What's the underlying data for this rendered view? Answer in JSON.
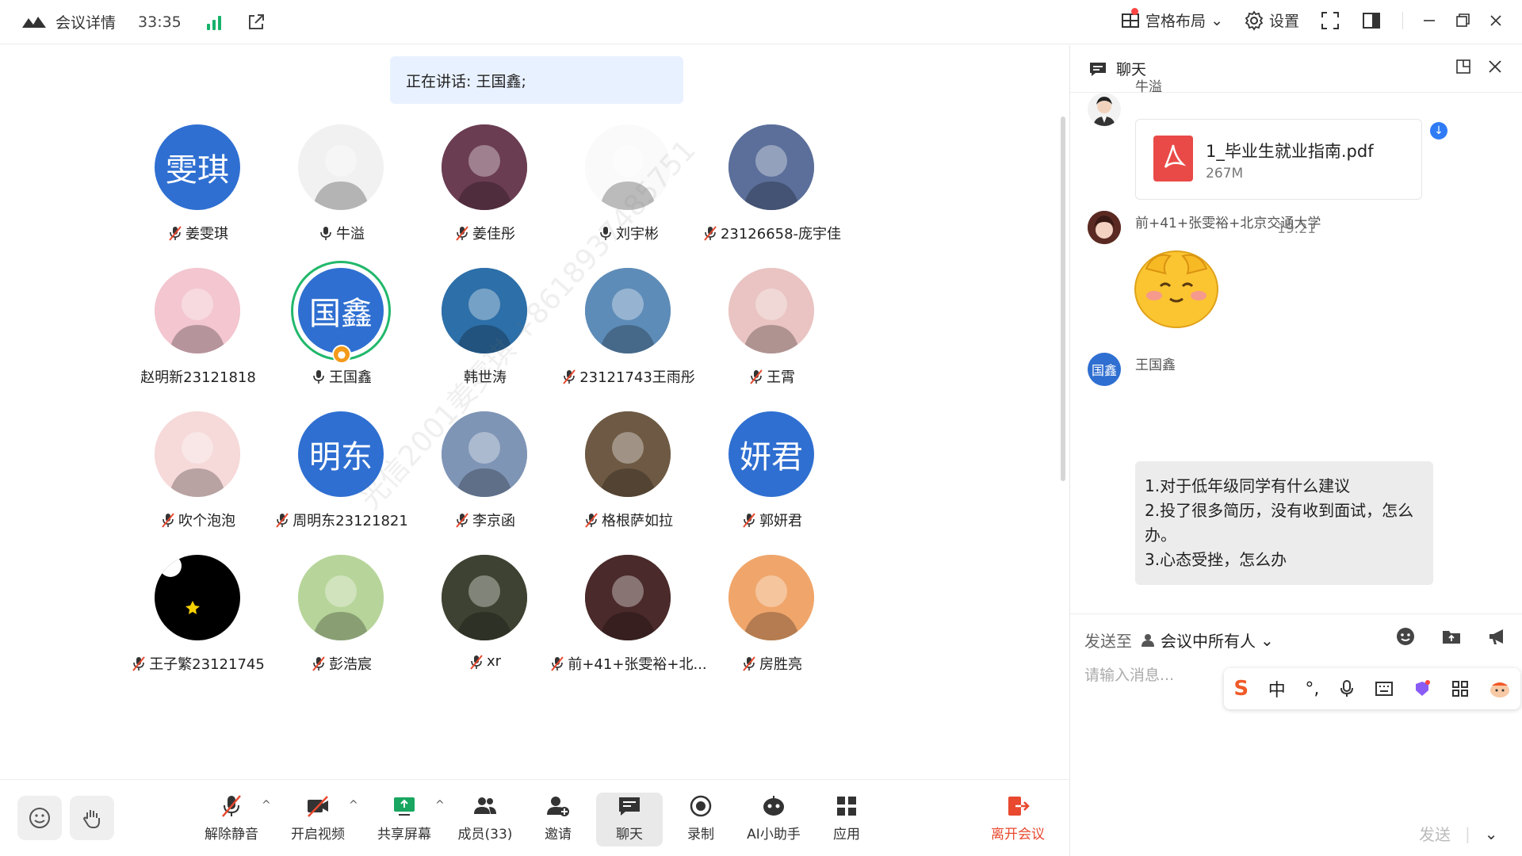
{
  "topbar": {
    "meeting_details": "会议详情",
    "timer": "33:35",
    "layout_label": "宫格布局",
    "settings_label": "设置"
  },
  "stage": {
    "speaking_prefix": "正在讲话: 王国鑫;",
    "watermark": "光信2001姜雯琪 +8618937485751"
  },
  "participants": [
    {
      "name": "姜雯琪",
      "avatar_text": "雯琪",
      "mic": "muted"
    },
    {
      "name": "牛溢",
      "avatar_text": "",
      "mic": "on"
    },
    {
      "name": "姜佳彤",
      "avatar_text": "",
      "mic": "muted"
    },
    {
      "name": "刘宇彬",
      "avatar_text": "",
      "mic": "on"
    },
    {
      "name": "23126658-庞宇佳",
      "avatar_text": "",
      "mic": "muted"
    },
    {
      "name": "赵明新23121818",
      "avatar_text": "",
      "mic": "none"
    },
    {
      "name": "王国鑫",
      "avatar_text": "国鑫",
      "mic": "on"
    },
    {
      "name": "韩世涛",
      "avatar_text": "",
      "mic": "none"
    },
    {
      "name": "23121743王雨彤",
      "avatar_text": "",
      "mic": "muted"
    },
    {
      "name": "王霄",
      "avatar_text": "",
      "mic": "muted"
    },
    {
      "name": "吹个泡泡",
      "avatar_text": "",
      "mic": "muted"
    },
    {
      "name": "周明东23121821",
      "avatar_text": "明东",
      "mic": "muted"
    },
    {
      "name": "李京函",
      "avatar_text": "",
      "mic": "muted"
    },
    {
      "name": "格根萨如拉",
      "avatar_text": "",
      "mic": "muted"
    },
    {
      "name": "郭妍君",
      "avatar_text": "妍君",
      "mic": "muted"
    },
    {
      "name": "王子繁23121745",
      "avatar_text": "",
      "mic": "muted"
    },
    {
      "name": "彭浩宸",
      "avatar_text": "",
      "mic": "muted"
    },
    {
      "name": "xr",
      "avatar_text": "",
      "mic": "muted"
    },
    {
      "name": "前+41+张雯裕+北...",
      "avatar_text": "",
      "mic": "muted"
    },
    {
      "name": "房胜亮",
      "avatar_text": "",
      "mic": "muted"
    }
  ],
  "controls": {
    "unmute": "解除静音",
    "start_video": "开启视频",
    "share_screen": "共享屏幕",
    "members": "成员(33)",
    "invite": "邀请",
    "chat": "聊天",
    "record": "录制",
    "ai_assistant": "AI小助手",
    "apps": "应用",
    "leave": "离开会议"
  },
  "chat": {
    "title": "聊天",
    "msg1_sender": "牛溢",
    "file_name": "1_毕业生就业指南.pdf",
    "file_size": "267M",
    "timestamp": "19:21",
    "msg2_sender": "前+41+张雯裕+北京交通大学",
    "msg3_sender": "王国鑫",
    "msg3_avatar_text": "国鑫",
    "msg3_lines": [
      "1.对于低年级同学有什么建议",
      "2.投了很多简历，没有收到面试，怎么办。",
      "3.心态受挫，怎么办"
    ],
    "send_to_label": "发送至",
    "send_to_target": "会议中所有人",
    "input_placeholder": "请输入消息...",
    "send_label": "发送"
  },
  "ime": {
    "zh_label": "中"
  },
  "colors": {
    "accent_blue": "#2f6fd1",
    "speaking_ring": "#21b86b",
    "leave_red": "#e8492f",
    "signal_green": "#17b26a"
  }
}
